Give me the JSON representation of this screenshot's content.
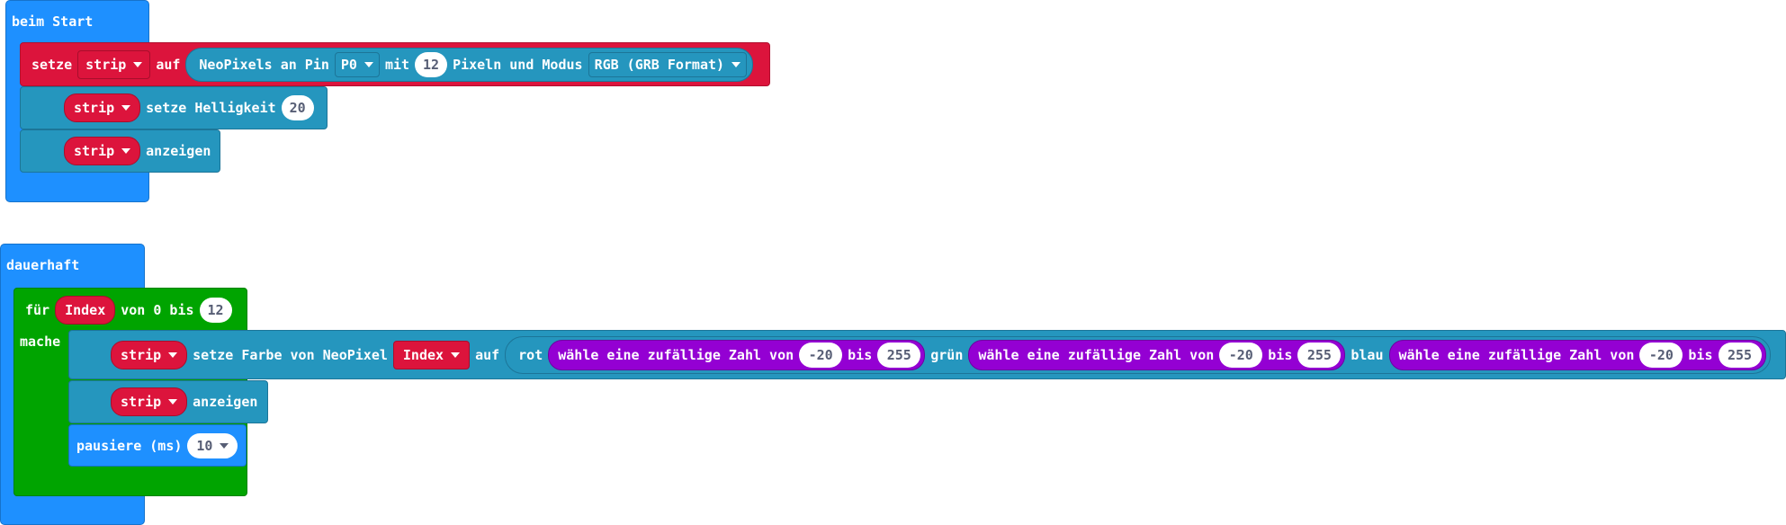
{
  "on_start": {
    "header": "beim Start",
    "set_block": {
      "label_set": "setze",
      "var": "strip",
      "label_to": "auf",
      "create": {
        "label_prefix": "NeoPixels an Pin",
        "pin": "P0",
        "label_with": "mit",
        "count": "12",
        "label_mode": "Pixeln und Modus",
        "mode": "RGB (GRB Format)"
      }
    },
    "brightness_block": {
      "var": "strip",
      "label": "setze Helligkeit",
      "value": "20"
    },
    "show_block": {
      "var": "strip",
      "label": "anzeigen"
    }
  },
  "forever": {
    "header": "dauerhaft",
    "for_block": {
      "label_for": "für",
      "var": "Index",
      "label_range": "von 0 bis",
      "end": "12",
      "label_do": "mache"
    },
    "set_color_block": {
      "var": "strip",
      "label": "setze Farbe von NeoPixel",
      "index_var": "Index",
      "label_to": "auf",
      "rgb": {
        "label_red": "rot",
        "label_green": "grün",
        "label_blue": "blau",
        "random_label": "wähle eine zufällige Zahl von",
        "random_to": "bis",
        "red": {
          "from": "-20",
          "to": "255"
        },
        "green": {
          "from": "-20",
          "to": "255"
        },
        "blue": {
          "from": "-20",
          "to": "255"
        }
      }
    },
    "show_block": {
      "var": "strip",
      "label": "anzeigen"
    },
    "pause_block": {
      "label": "pausiere (ms)",
      "value": "10"
    }
  },
  "colors": {
    "event": "#1e90ff",
    "neopixel": "#2596be",
    "variable": "#dc143c",
    "loop": "#00a400",
    "math": "#9400d3"
  }
}
